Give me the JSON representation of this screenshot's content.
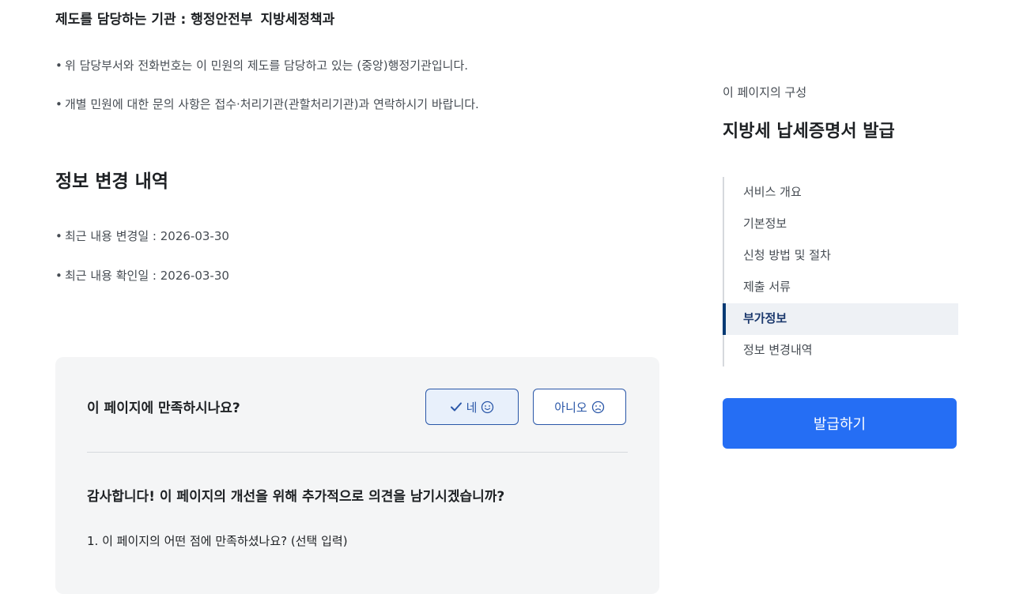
{
  "content": {
    "org_label": "제도를 담당하는 기관 : 행정안전부",
    "org_dept": "지방세정책과",
    "notes": [
      "위 담당부서와 전화번호는 이 민원의 제도를 담당하고 있는 (중앙)행정기관입니다.",
      "개별 민원에 대한 문의 사항은 접수·처리기관(관할처리기관)과 연락하시기 바랍니다."
    ],
    "change_history": {
      "title": "정보 변경 내역",
      "items": [
        "최근 내용 변경일 : 2026-03-30",
        "최근 내용 확인일 : 2026-03-30"
      ]
    }
  },
  "survey": {
    "question": "이 페이지에 만족하시나요?",
    "yes_label": "네",
    "no_label": "아니오",
    "thanks": "감사합니다! 이 페이지의 개선을 위해 추가적으로 의견을 남기시겠습니까?",
    "q1": "1. 이 페이지의 어떤 점에 만족하셨나요? (선택 입력)"
  },
  "aside": {
    "caption": "이 페이지의 구성",
    "title": "지방세 납세증명서 발급",
    "toc": [
      "서비스 개요",
      "기본정보",
      "신청 방법 및 절차",
      "제출 서류",
      "부가정보",
      "정보 변경내역"
    ],
    "active_index": 4,
    "issue_button": "발급하기"
  },
  "colors": {
    "primary": "#256ef4",
    "active_bar": "#063a74",
    "survey_border": "#2a57a8",
    "survey_bg": "#f4f5f6"
  },
  "icons": [
    "check-icon",
    "smile-icon",
    "frown-icon"
  ]
}
